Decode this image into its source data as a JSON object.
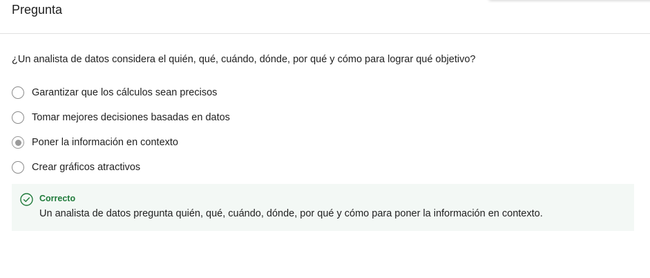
{
  "header": {
    "title": "Pregunta"
  },
  "question": {
    "text": "¿Un analista de datos considera el quién, qué, cuándo, dónde, por qué y cómo para lograr qué objetivo?",
    "options": [
      {
        "label": "Garantizar que los cálculos sean precisos",
        "selected": false
      },
      {
        "label": "Tomar mejores decisiones basadas en datos",
        "selected": false
      },
      {
        "label": "Poner la información en contexto",
        "selected": true
      },
      {
        "label": "Crear gráficos atractivos",
        "selected": false
      }
    ]
  },
  "feedback": {
    "status": "Correcto",
    "message": "Un analista de datos pregunta quién, qué, cuándo, dónde, por qué y cómo para poner la información en contexto.",
    "icon": "check-circle-icon",
    "color": "#1f7a3a",
    "background": "#f3f8f5"
  }
}
